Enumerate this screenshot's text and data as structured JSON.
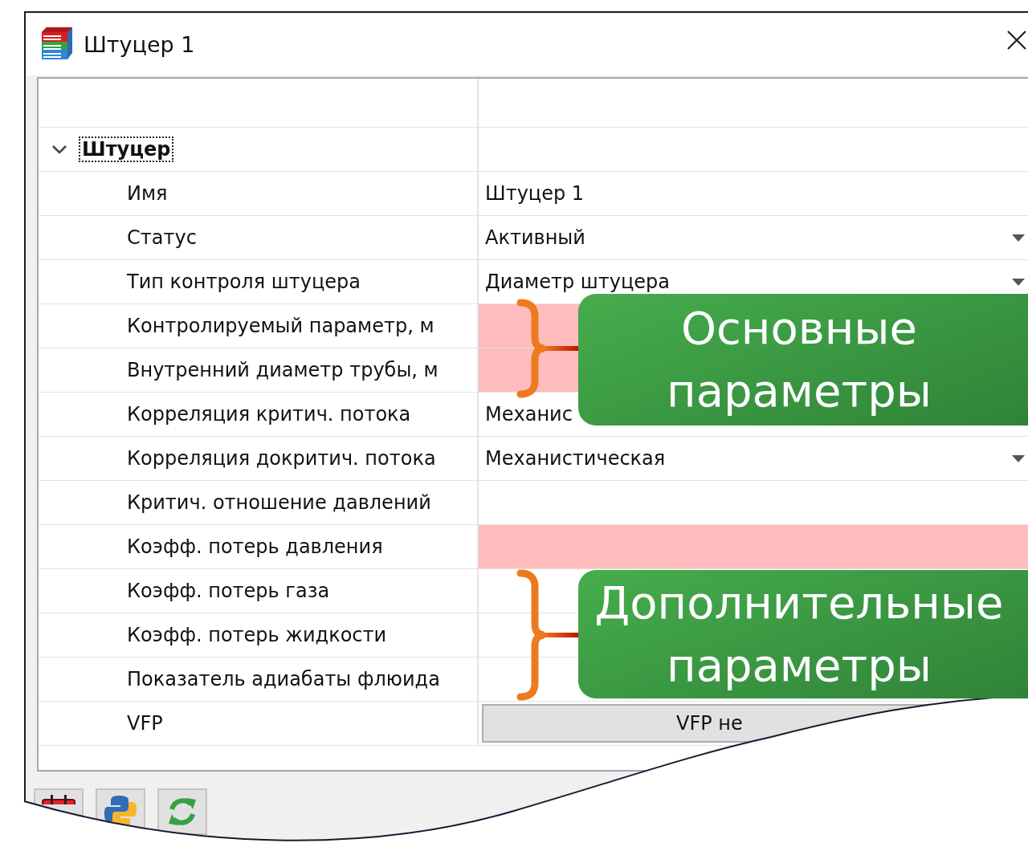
{
  "window": {
    "title": "Штуцер 1"
  },
  "group": {
    "label": "Штуцер",
    "expanded": true
  },
  "rows": [
    {
      "label": "Имя",
      "kind": "text",
      "value": "Штуцер 1",
      "invalid": false
    },
    {
      "label": "Статус",
      "kind": "dropdown",
      "value": "Активный",
      "invalid": false
    },
    {
      "label": "Тип контроля штуцера",
      "kind": "dropdown",
      "value": "Диаметр штуцера",
      "invalid": false
    },
    {
      "label": "Контролируемый параметр, м",
      "kind": "text",
      "invalid": true
    },
    {
      "label": "Внутренний диаметр трубы, м",
      "kind": "text",
      "invalid": true
    },
    {
      "label": "Корреляция критич. потока",
      "kind": "text",
      "value": "Механис",
      "invalid": false
    },
    {
      "label": "Корреляция докритич. потока",
      "kind": "dropdown",
      "value": "Механистическая",
      "invalid": false
    },
    {
      "label": "Критич. отношение давлений",
      "kind": "text",
      "invalid": false
    },
    {
      "label": "Коэфф. потерь давления",
      "kind": "text",
      "invalid": true
    },
    {
      "label": "Коэфф. потерь газа",
      "kind": "text",
      "invalid": false
    },
    {
      "label": "Коэфф. потерь жидкости",
      "kind": "text",
      "invalid": false
    },
    {
      "label": "Показатель адиабаты флюида",
      "kind": "text",
      "invalid": false
    },
    {
      "label": "VFP",
      "kind": "button",
      "value": "VFP не",
      "invalid": false
    }
  ],
  "callouts": [
    {
      "text": "Основные параметры"
    },
    {
      "text": "Дополнительные параметры"
    }
  ]
}
